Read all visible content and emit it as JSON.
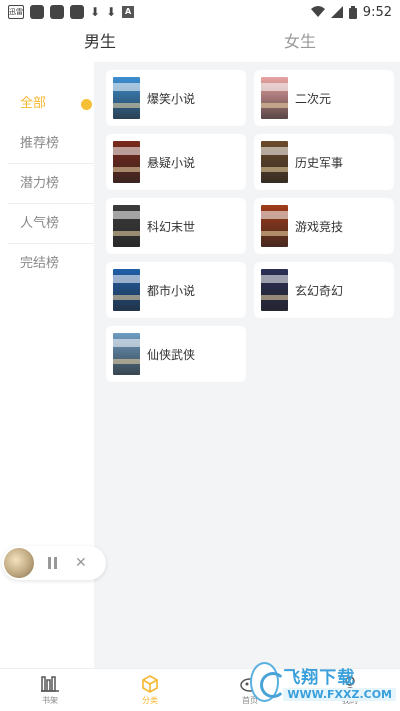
{
  "status_bar": {
    "app_icon_text": "迅雷",
    "time": "9:52",
    "letter_icon": "A"
  },
  "gender_tabs": [
    {
      "label": "男生",
      "active": true
    },
    {
      "label": "女生",
      "active": false
    }
  ],
  "sidebar": {
    "items": [
      {
        "label": "全部",
        "active": true
      },
      {
        "label": "推荐榜",
        "active": false
      },
      {
        "label": "潜力榜",
        "active": false
      },
      {
        "label": "人气榜",
        "active": false
      },
      {
        "label": "完结榜",
        "active": false
      }
    ]
  },
  "categories": [
    {
      "label": "爆笑小说",
      "cover_color": "#3d8fd1"
    },
    {
      "label": "二次元",
      "cover_color": "#e8a3a3"
    },
    {
      "label": "悬疑小说",
      "cover_color": "#7a2a1c"
    },
    {
      "label": "历史军事",
      "cover_color": "#6b4a2a"
    },
    {
      "label": "科幻末世",
      "cover_color": "#3b3b3b"
    },
    {
      "label": "游戏竞技",
      "cover_color": "#a03c1a"
    },
    {
      "label": "都市小说",
      "cover_color": "#1f5fa8"
    },
    {
      "label": "玄幻奇幻",
      "cover_color": "#2b2e55"
    },
    {
      "label": "仙侠武侠",
      "cover_color": "#6e9cc2"
    }
  ],
  "player": {
    "state": "paused"
  },
  "bottom_nav": [
    {
      "label": "书架",
      "icon": "bookshelf-icon",
      "active": false
    },
    {
      "label": "分类",
      "icon": "category-cube-icon",
      "active": true
    },
    {
      "label": "首页",
      "icon": "home-icon",
      "active": false
    },
    {
      "label": "我的",
      "icon": "profile-icon",
      "active": false
    }
  ],
  "watermark": {
    "main": "飞翔下载",
    "sub": "WWW.FXXZ.COM"
  },
  "colors": {
    "accent": "#f5b830",
    "background": "#f3f4f6",
    "watermark": "#3aa0dc"
  }
}
